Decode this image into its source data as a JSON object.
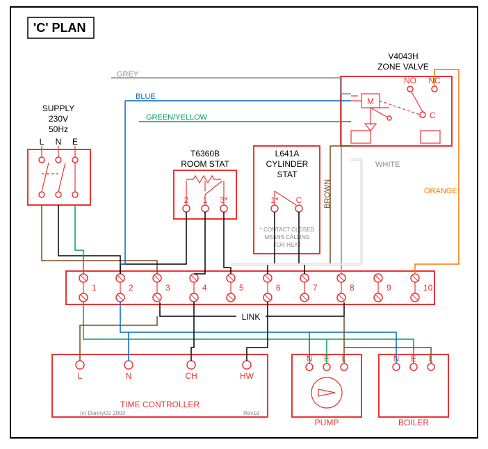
{
  "title": "'C' PLAN",
  "supply": {
    "label": "SUPPLY",
    "voltage": "230V",
    "freq": "50Hz",
    "L": "L",
    "N": "N",
    "E": "E"
  },
  "zone_valve": {
    "model": "V4043H",
    "label": "ZONE VALVE",
    "M": "M",
    "NO": "NO",
    "NC": "NC",
    "C": "C"
  },
  "room_stat": {
    "model": "T6360B",
    "label": "ROOM STAT",
    "t1": "1",
    "t2": "2",
    "t3": "3*"
  },
  "cyl_stat": {
    "model": "L641A",
    "label": "CYLINDER",
    "label2": "STAT",
    "t1": "1*",
    "tC": "C",
    "note1": "* CONTACT CLOSED",
    "note2": "MEANS CALLING",
    "note3": "FOR HEAT"
  },
  "terminal_strip": {
    "labels": [
      "1",
      "2",
      "3",
      "4",
      "5",
      "6",
      "7",
      "8",
      "9",
      "10"
    ],
    "link": "LINK"
  },
  "time_controller": {
    "label": "TIME CONTROLLER",
    "L": "L",
    "N": "N",
    "CH": "CH",
    "HW": "HW"
  },
  "pump": {
    "label": "PUMP",
    "N": "N",
    "E": "E",
    "L": "L"
  },
  "boiler": {
    "label": "BOILER",
    "N": "N",
    "E": "E",
    "L": "L"
  },
  "wire_labels": {
    "grey": "GREY",
    "blue": "BLUE",
    "greenyellow": "GREEN/YELLOW",
    "white": "WHITE",
    "orange": "ORANGE",
    "brown": "BROWN"
  },
  "credits": {
    "copyright": "(c) DannyOz 2003",
    "rev": "Rev1d"
  }
}
